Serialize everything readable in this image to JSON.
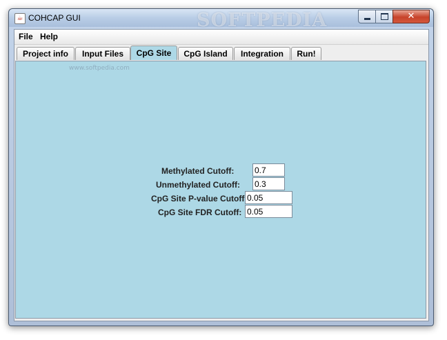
{
  "window": {
    "title": "COHCAP GUI",
    "watermark": "SOFTPEDIA"
  },
  "menu": {
    "items": [
      {
        "label": "File"
      },
      {
        "label": "Help"
      }
    ]
  },
  "tabs": [
    {
      "label": "Project info",
      "selected": false
    },
    {
      "label": "Input Files",
      "selected": false
    },
    {
      "label": "CpG Site",
      "selected": true
    },
    {
      "label": "CpG Island",
      "selected": false
    },
    {
      "label": "Integration",
      "selected": false
    },
    {
      "label": "Run!",
      "selected": false
    }
  ],
  "panel": {
    "watermark_small": "www.softpedia.com",
    "background_color": "#add8e6",
    "fields": [
      {
        "label": "Methylated Cutoff:",
        "value": "0.7"
      },
      {
        "label": "Unmethylated Cutoff:",
        "value": "0.3"
      },
      {
        "label": "CpG Site P-value Cutoff:",
        "value": "0.05"
      },
      {
        "label": "CpG Site FDR Cutoff:",
        "value": "0.05"
      }
    ]
  }
}
